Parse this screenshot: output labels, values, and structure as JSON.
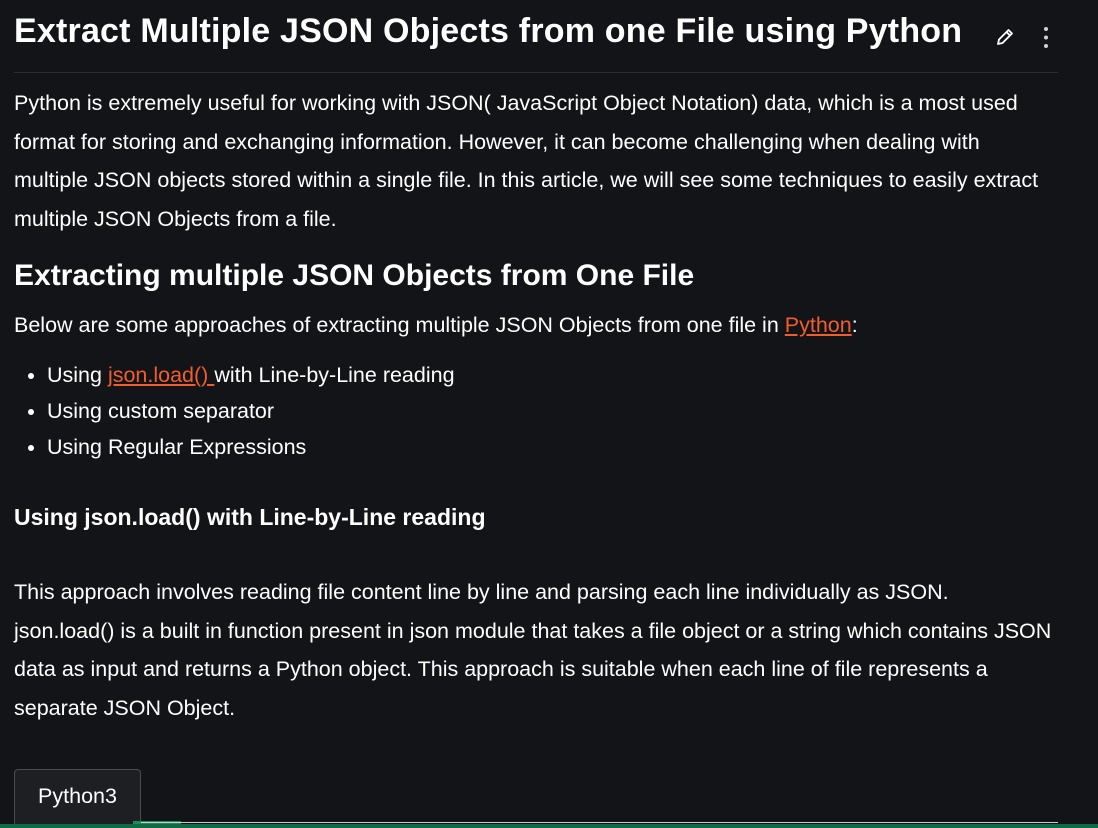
{
  "article": {
    "title": "Extract Multiple JSON Objects from one File using Python",
    "intro": "Python is extremely useful for working with JSON( JavaScript Object Notation) data, which is a most used format for storing and exchanging information. However, it can become challenging when dealing with multiple JSON objects stored within a single file. In this article, we will see some techniques to easily extract multiple JSON Objects from a file.",
    "section_heading": "Extracting multiple JSON Objects from One File",
    "approaches_lead_prefix": "Below are some approaches of extracting multiple JSON Objects from one file in ",
    "approaches_lead_link": "Python",
    "approaches_lead_suffix": ":",
    "approaches": [
      {
        "prefix": "Using ",
        "link": "json.load() ",
        "suffix": "with Line-by-Line reading"
      },
      {
        "text": "Using custom separator"
      },
      {
        "text": "Using Regular Expressions"
      }
    ],
    "subheading": "Using json.load() with Line-by-Line reading",
    "body": "This approach involves reading file content line by line and parsing each line individually as JSON. json.load() is a built in function present in json module that takes a file object or a string which contains JSON data as input and returns a Python object. This approach is suitable when each line of file represents a separate JSON Object.",
    "code_tab": "Python3"
  },
  "icons": {
    "edit": "pencil-icon",
    "more": "more-vertical-icon"
  },
  "colors": {
    "background": "#131417",
    "text": "#ffffff",
    "link": "#f25d2e",
    "accent": "#1f8a5a"
  }
}
